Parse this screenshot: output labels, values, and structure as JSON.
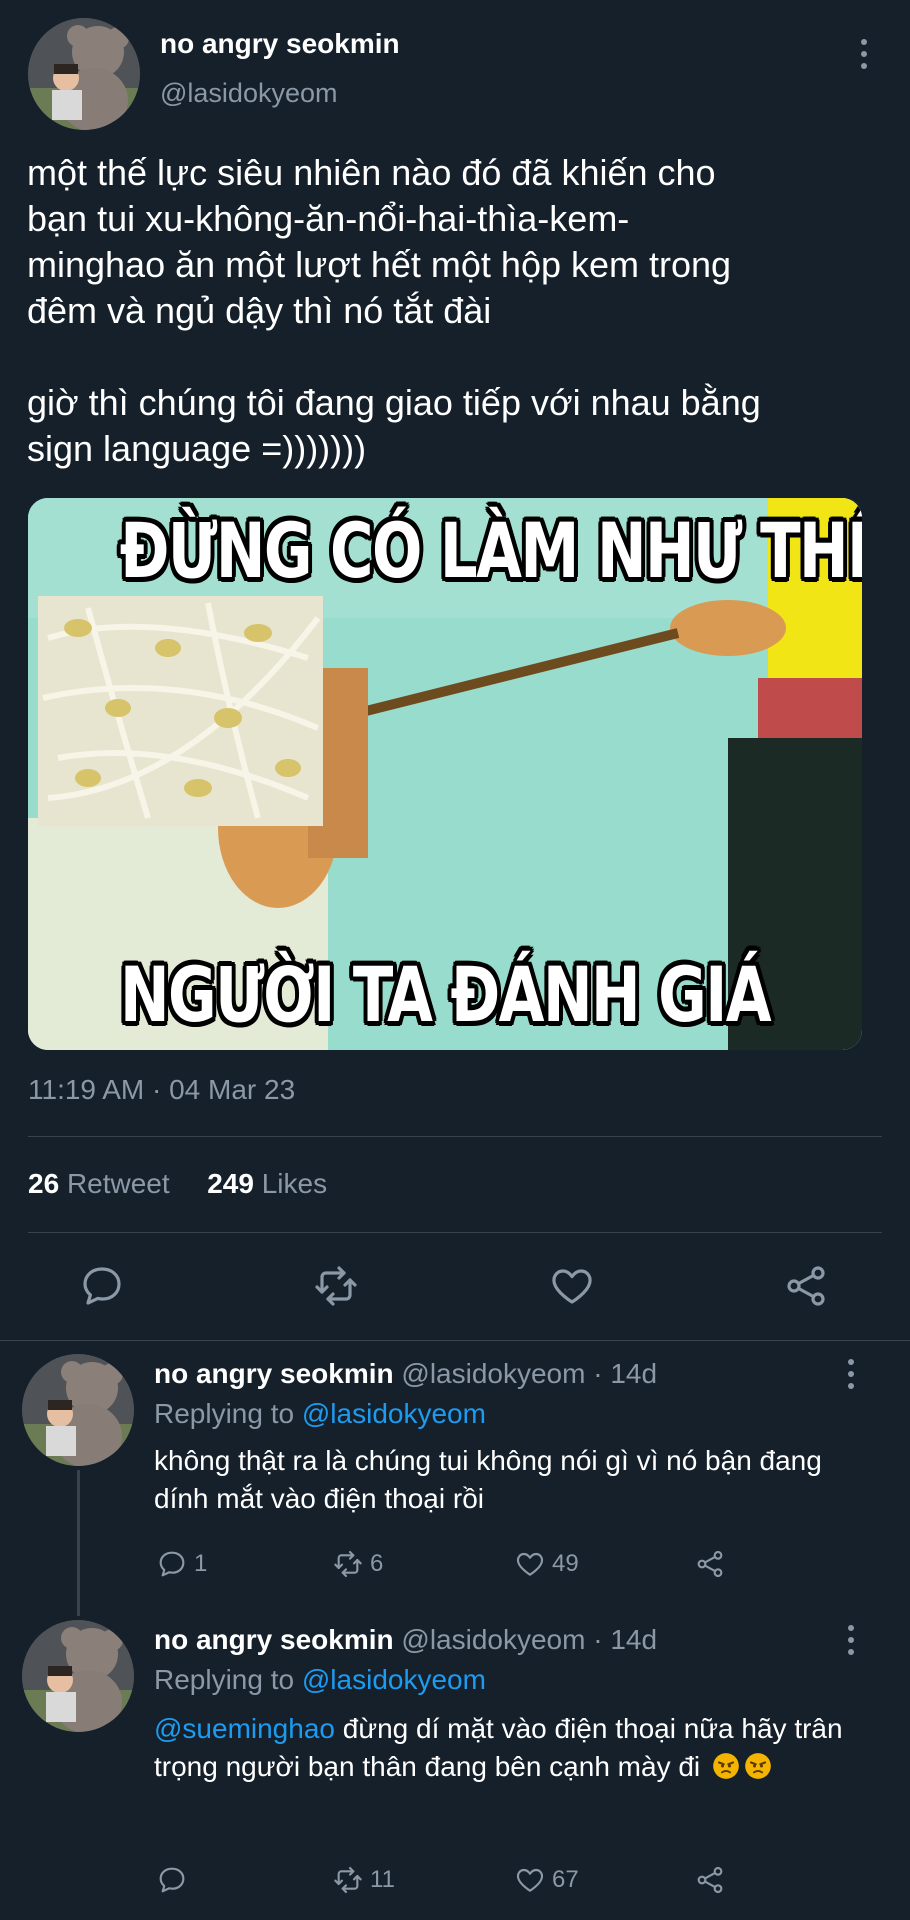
{
  "tweet": {
    "author_name": "no angry seokmin",
    "author_handle": "@lasidokyeom",
    "text": "một thế lực siêu nhiên nào đó đã khiến cho\nbạn tui xu-không-ăn-nổi-hai-thìa-kem-\nminghao ăn một lượt hết một hộp kem trong\nđêm và ngủ dậy thì nó tắt đài\n\ngiờ thì chúng tôi đang giao tiếp với nhau bằng\nsign language =)))))))",
    "image_caption_top": "ĐỪNG CÓ LÀM NHƯ THẾ",
    "image_caption_bottom": "NGƯỜI TA ĐÁNH GIÁ",
    "timestamp": "11:19 AM · 04 Mar 23",
    "retweets_count": "26",
    "retweets_label": "Retweet",
    "likes_count": "249",
    "likes_label": "Likes",
    "actions": [
      "reply-icon",
      "retweet-icon",
      "like-icon",
      "share-icon"
    ]
  },
  "replies": [
    {
      "author_name": "no angry seokmin",
      "author_handle": "@lasidokyeom",
      "separator": "·",
      "time": "14d",
      "replying_prefix": "Replying to",
      "replying_to": "@lasidokyeom",
      "text": "không thật ra là chúng tui không nói gì vì nó bận đang dính mắt vào điện thoại rồi",
      "reply_count": "1",
      "retweet_count": "6",
      "like_count": "49"
    },
    {
      "author_name": "no angry seokmin",
      "author_handle": "@lasidokyeom",
      "separator": "·",
      "time": "14d",
      "replying_prefix": "Replying to",
      "replying_to": "@lasidokyeom",
      "mention": "@sueminghao",
      "text": " đừng dí mặt vào điện thoại nữa hãy trân trọng người bạn thân đang bên cạnh mày đi",
      "emojis": [
        "angry-face-emoji",
        "angry-face-emoji"
      ],
      "reply_count": "",
      "retweet_count": "11",
      "like_count": "67"
    }
  ],
  "colors": {
    "background": "#15202b",
    "text_primary": "#ffffff",
    "text_secondary": "#8b98a5",
    "link": "#1d9bf0",
    "divider": "#38444d"
  }
}
